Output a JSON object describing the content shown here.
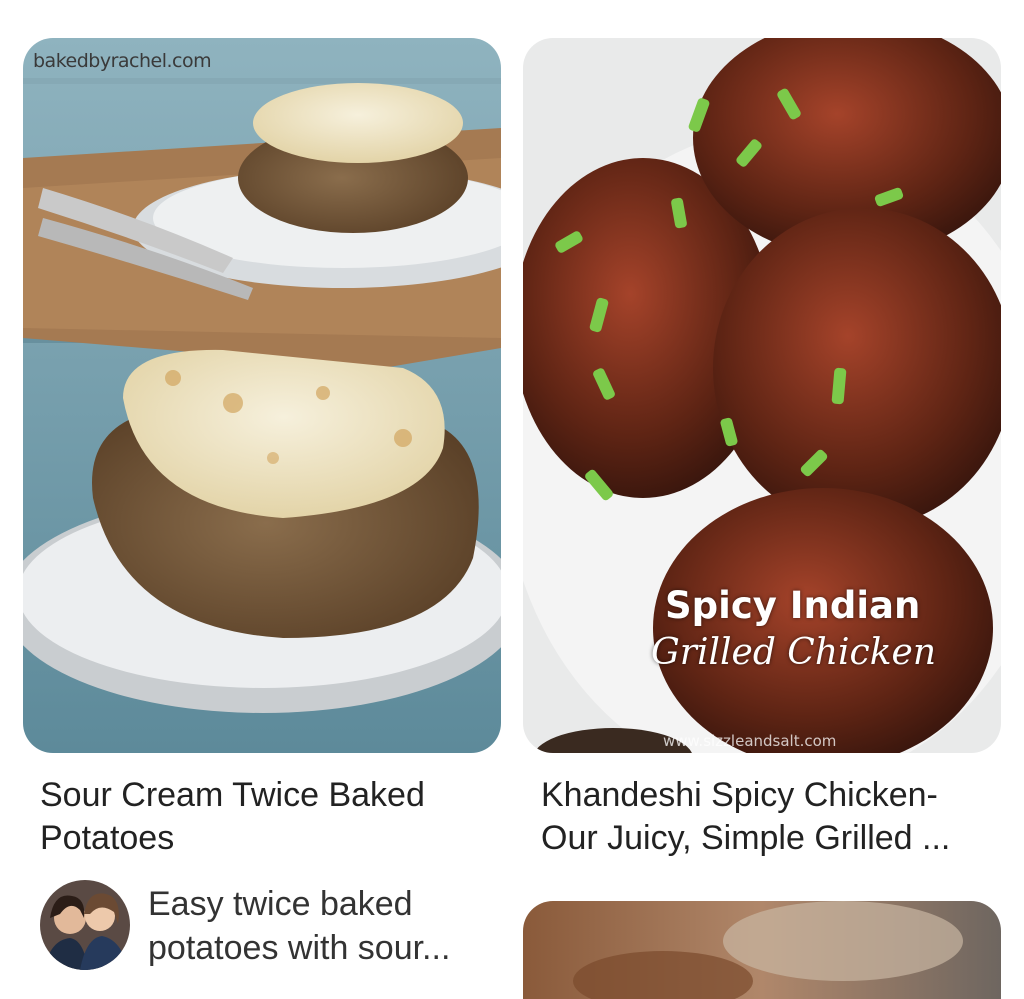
{
  "pins": [
    {
      "title": "Sour Cream Twice Baked Potatoes",
      "image_watermark": "bakedbyrachel.com",
      "image_description": "twice baked potato with sour cream filling",
      "pinner": {
        "avatar_icon": "user-avatar",
        "description": "Easy twice baked potatoes with sour..."
      }
    },
    {
      "title": "Khandeshi Spicy Chicken- Our Juicy, Simple Grilled ...",
      "image_overlay_line1": "Spicy Indian",
      "image_overlay_line2": "Grilled Chicken",
      "image_watermark": "www.sizzleandsalt.com",
      "image_description": "grilled chicken thighs garnished with scallions"
    },
    {
      "image_description": "partially visible food photo"
    }
  ],
  "colors": {
    "background": "#ffffff",
    "title_text": "#222222",
    "desc_text": "#333333"
  }
}
